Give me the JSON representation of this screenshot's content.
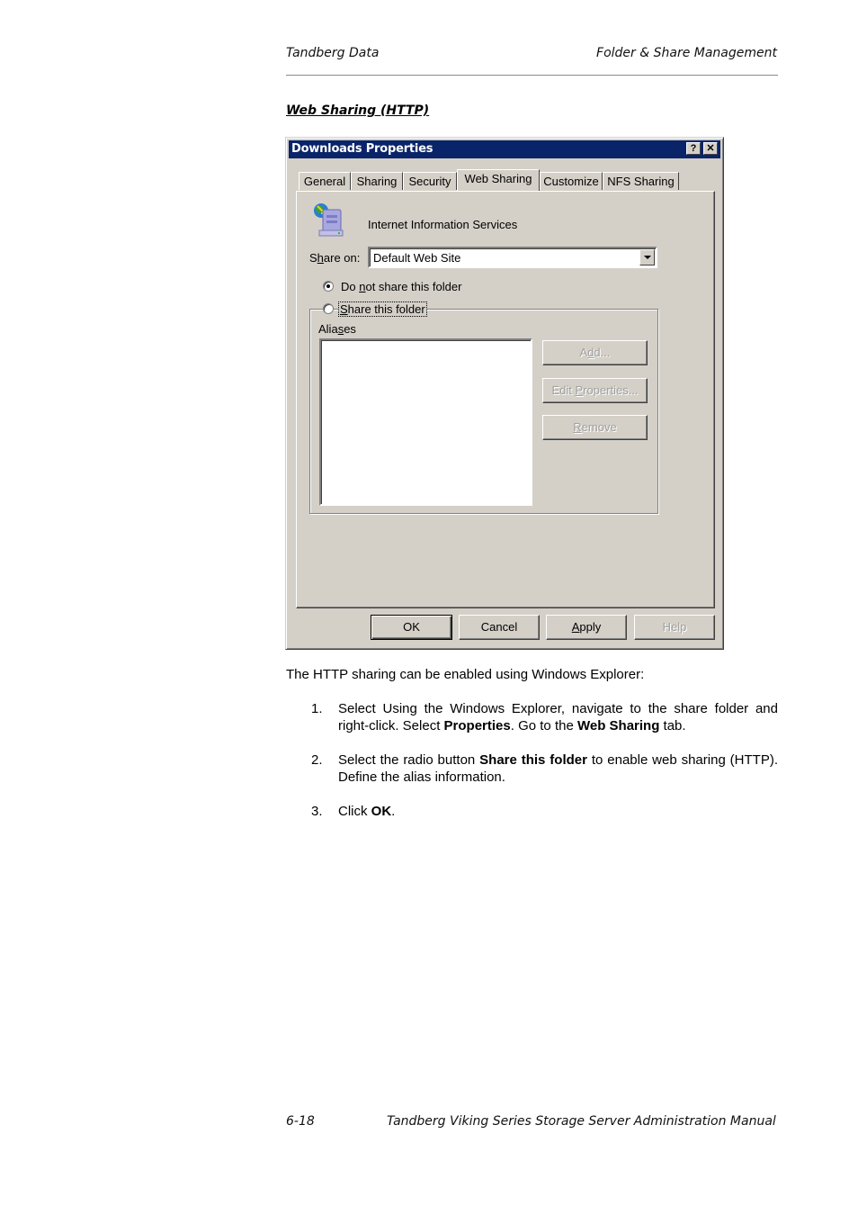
{
  "page_header": {
    "left": "Tandberg Data",
    "right": "Folder & Share Management"
  },
  "section_title": "Web Sharing (HTTP)",
  "dialog": {
    "title": "Downloads Properties",
    "title_buttons": {
      "help": "?",
      "close": "✕"
    },
    "tabs": [
      {
        "label": "General",
        "active": false
      },
      {
        "label": "Sharing",
        "active": false
      },
      {
        "label": "Security",
        "active": false
      },
      {
        "label": "Web Sharing",
        "active": true
      },
      {
        "label": "Customize",
        "active": false
      },
      {
        "label": "NFS Sharing",
        "active": false
      }
    ],
    "service_icon": "iis-server-globe-icon",
    "service_label": "Internet Information Services",
    "share_on_label_pre": "S",
    "share_on_label_mnemonic": "h",
    "share_on_label_post": "are on:",
    "share_on_value": "Default Web Site",
    "radio_options": [
      {
        "pre": "Do ",
        "mnemonic": "n",
        "post": "ot share this folder",
        "checked": true
      },
      {
        "pre": "",
        "mnemonic": "S",
        "post": "hare this folder",
        "checked": false
      }
    ],
    "aliases_label_pre": "Alia",
    "aliases_label_mnemonic": "s",
    "aliases_label_post": "es",
    "aliases": [],
    "alias_buttons": [
      {
        "pre": "A",
        "mnemonic": "d",
        "post": "d...",
        "enabled": false
      },
      {
        "pre": "Edit ",
        "mnemonic": "P",
        "post": "roperties...",
        "enabled": false
      },
      {
        "pre": "",
        "mnemonic": "R",
        "post": "emove",
        "enabled": false
      }
    ],
    "footer_buttons": {
      "ok": "OK",
      "cancel": "Cancel",
      "apply_mnemonic": "A",
      "apply_post": "pply",
      "help": "Help"
    }
  },
  "intro": "The HTTP sharing can be enabled using Windows Explorer:",
  "steps": [
    {
      "num": "1.",
      "a": "Select Using the Windows Explorer, navigate to the share folder and right-click. Select ",
      "b": "Properties",
      "c": ". Go to the ",
      "d": "Web Sharing",
      "e": " tab."
    },
    {
      "num": "2.",
      "a": "Select the radio button ",
      "b": "Share this folder",
      "c": " to enable web sharing (HTTP). Define the alias information."
    },
    {
      "num": "3.",
      "a": "Click ",
      "b": "OK",
      "c": "."
    }
  ],
  "page_footer": {
    "page_number": "6-18",
    "manual_title": "Tandberg Viking Series Storage Server Administration Manual"
  }
}
